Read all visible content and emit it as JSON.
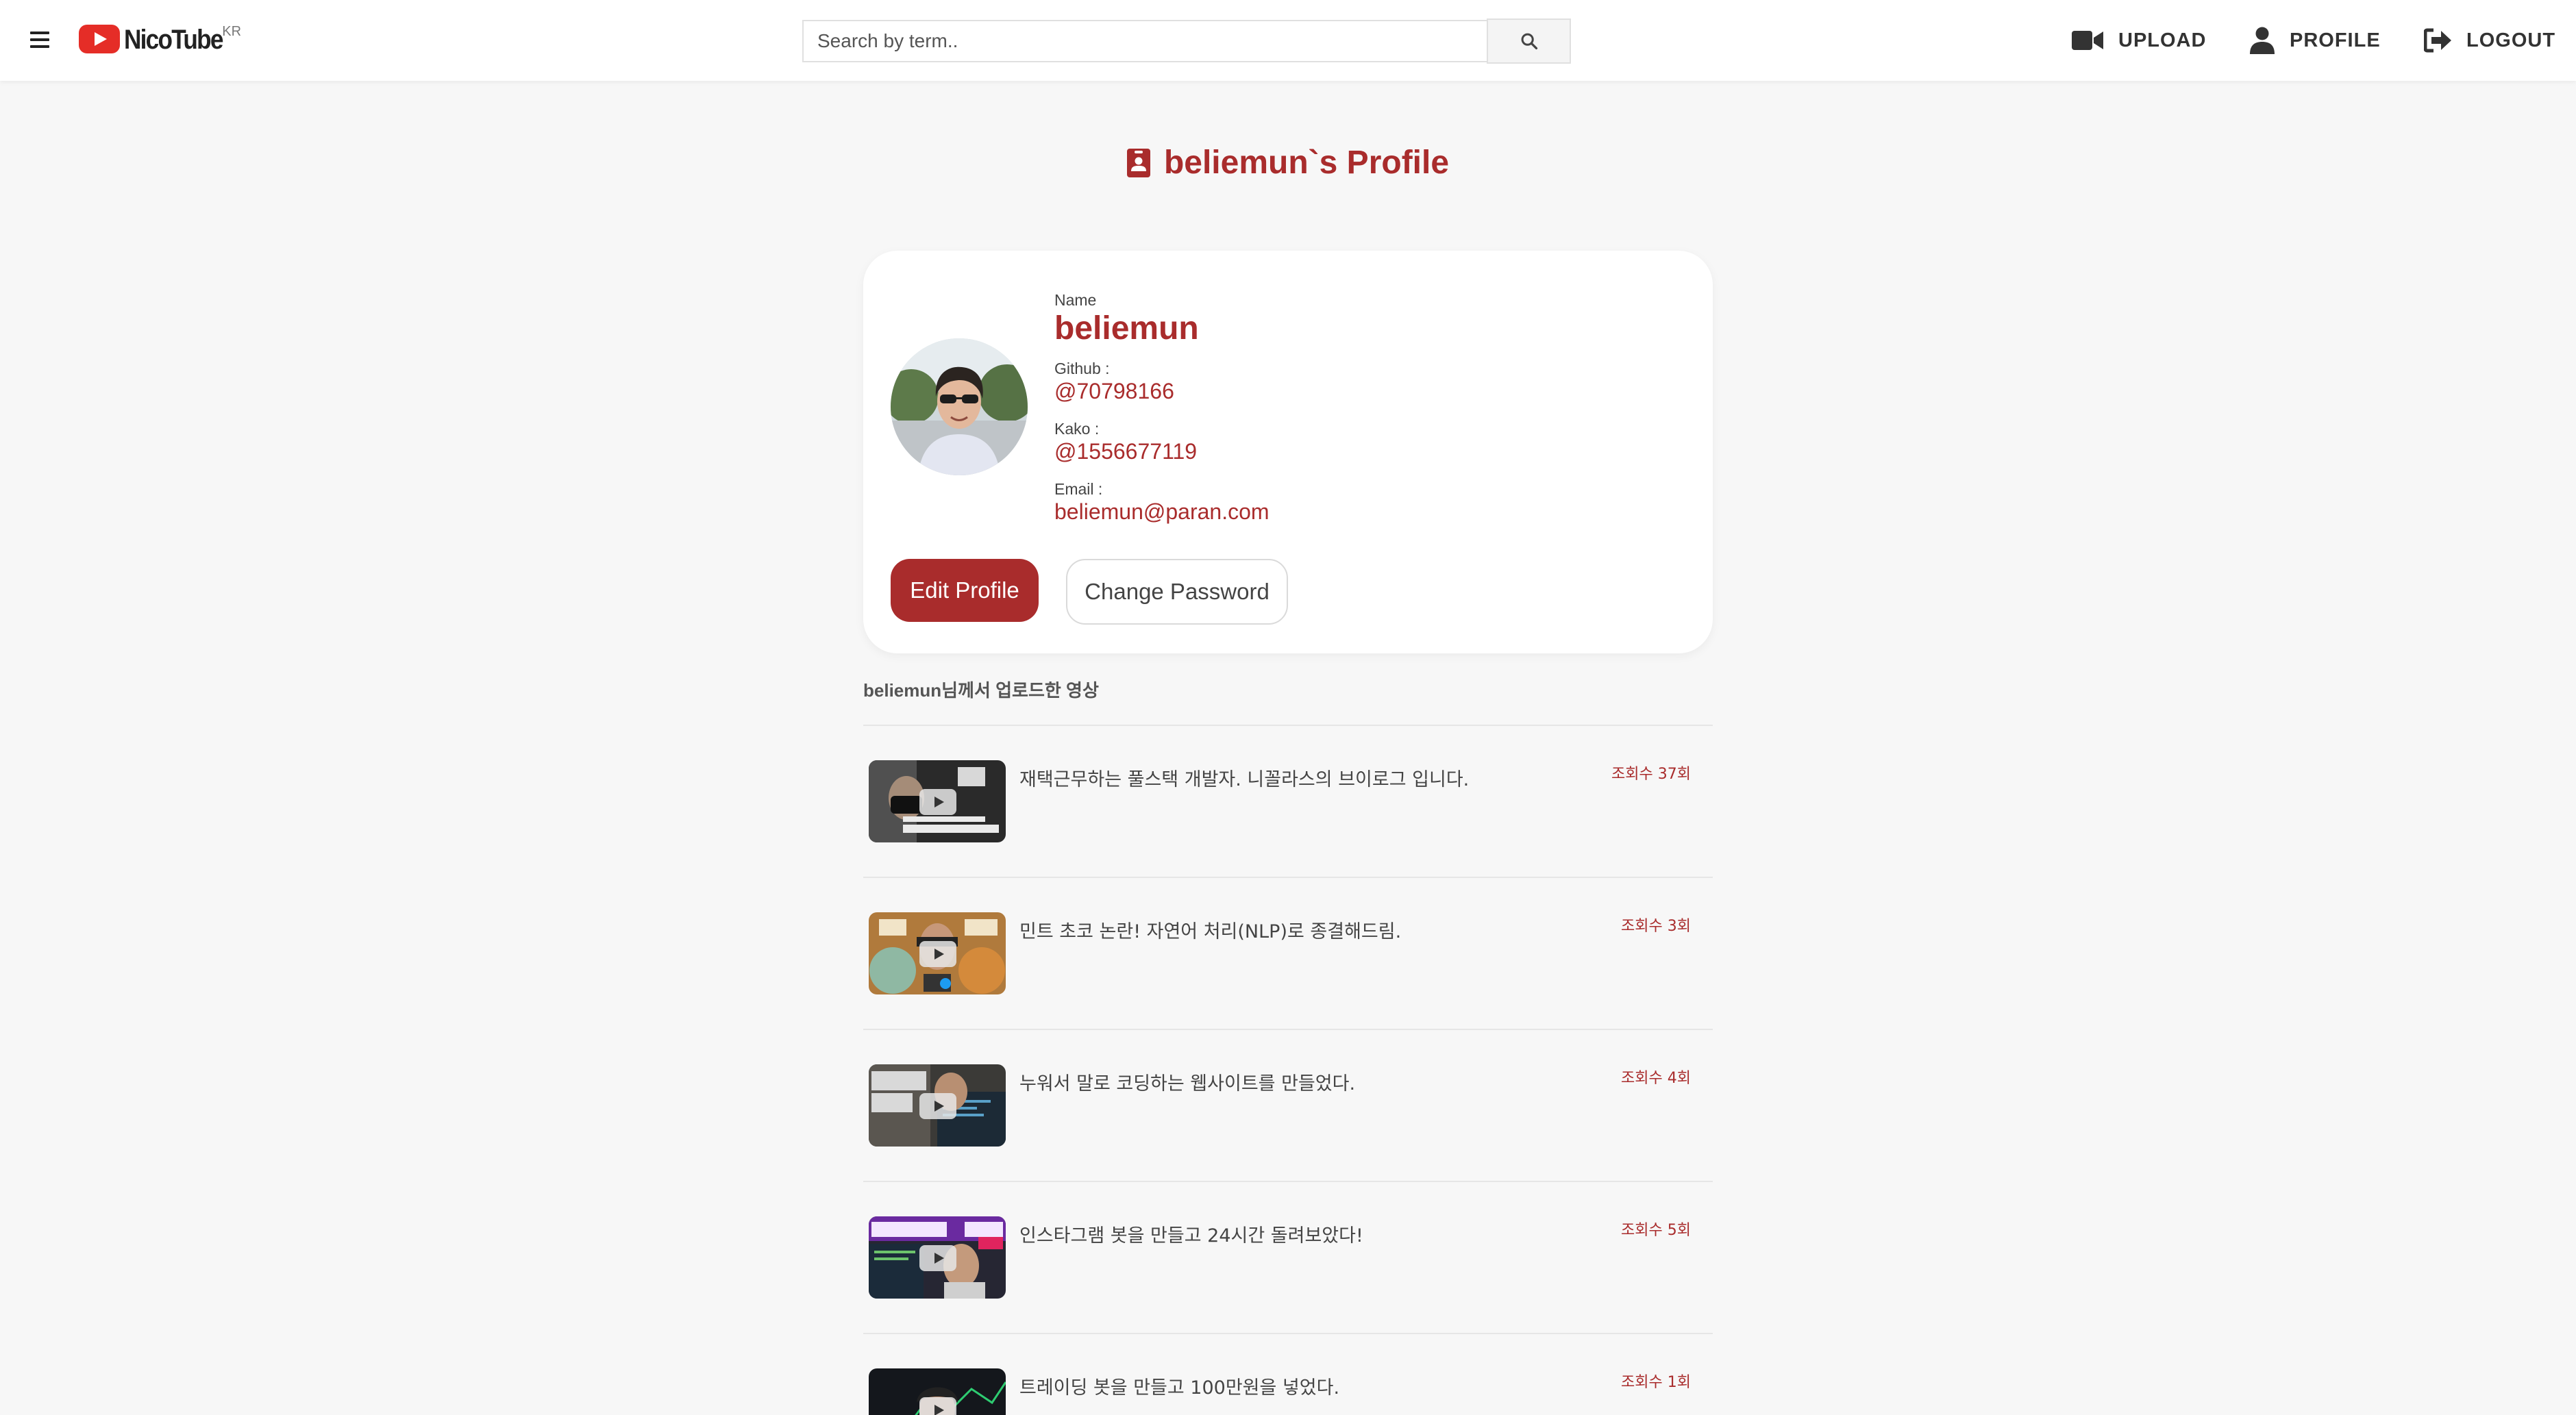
{
  "header": {
    "logo_text": "NicoTube",
    "logo_sup": "KR",
    "search_placeholder": "Search by term..",
    "nav": {
      "upload": "UPLOAD",
      "profile": "PROFILE",
      "logout": "LOGOUT"
    }
  },
  "page_title": "beliemun`s Profile",
  "profile": {
    "name_label": "Name",
    "name": "beliemun",
    "github_label": "Github :",
    "github": "@70798166",
    "kakao_label": "Kako :",
    "kakao": "@1556677119",
    "email_label": "Email :",
    "email": "beliemun@paran.com",
    "edit_button": "Edit Profile",
    "password_button": "Change Password"
  },
  "videos_heading": "beliemun님께서 업로드한 영상",
  "videos": [
    {
      "title": "재택근무하는 풀스택 개발자. 니꼴라스의 브이로그 입니다.",
      "views": "조회수 37회"
    },
    {
      "title": "민트 초코 논란! 자연어 처리(NLP)로 종결해드림.",
      "views": "조회수 3회"
    },
    {
      "title": "누워서 말로 코딩하는 웹사이트를 만들었다.",
      "views": "조회수 4회"
    },
    {
      "title": "인스타그램 봇을 만들고 24시간 돌려보았다!",
      "views": "조회수 5회"
    },
    {
      "title": "트레이딩 봇을 만들고 100만원을 넣었다.",
      "views": "조회수 1회"
    }
  ],
  "colors": {
    "accent": "#a92c2c",
    "logo_red": "#e52d27",
    "background": "#f7f7f7"
  }
}
